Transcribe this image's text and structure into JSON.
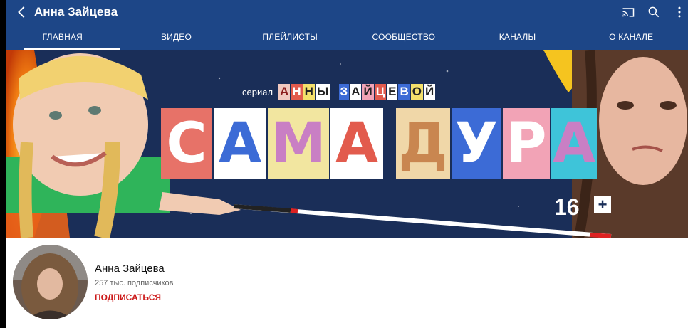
{
  "header": {
    "title": "Анна Зайцева",
    "icons": [
      "back-arrow-icon",
      "cast-icon",
      "search-icon",
      "more-vert-icon"
    ]
  },
  "tabs": [
    {
      "label": "ГЛАВНАЯ",
      "active": true
    },
    {
      "label": "ВИДЕО",
      "active": false
    },
    {
      "label": "ПЛЕЙЛИСТЫ",
      "active": false
    },
    {
      "label": "СООБЩЕСТВО",
      "active": false
    },
    {
      "label": "КАНАЛЫ",
      "active": false
    },
    {
      "label": "О КАНАЛЕ",
      "active": false
    }
  ],
  "banner": {
    "serial_label": "сериал",
    "subtitle_letters": [
      "А",
      "Н",
      "Н",
      "Ы",
      " ",
      "З",
      "А",
      "Й",
      "Ц",
      "Е",
      "В",
      "О",
      "Й"
    ],
    "big_letters": [
      "С",
      "А",
      "М",
      "А",
      "Д",
      "У",
      "Р",
      "А"
    ],
    "age_rating": "16",
    "age_plus": "+"
  },
  "channel": {
    "name": "Анна Зайцева",
    "subscribers": "257 тыс. подписчиков",
    "subscribe_label": "ПОДПИСАТЬСЯ"
  },
  "colors": {
    "appbar": "#1d4687",
    "subscribe_red": "#cc1a1a",
    "banner_bg": "#1a2e58"
  }
}
